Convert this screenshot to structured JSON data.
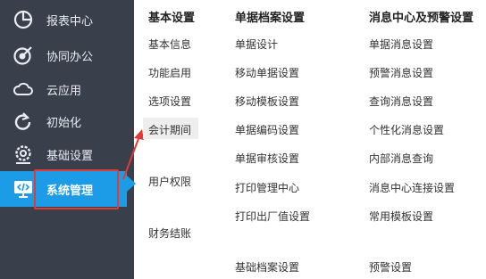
{
  "sidebar": {
    "items": [
      {
        "label": "报表中心",
        "icon": "pie-chart-icon"
      },
      {
        "label": "协同办公",
        "icon": "target-icon"
      },
      {
        "label": "云应用",
        "icon": "cloud-icon"
      },
      {
        "label": "初始化",
        "icon": "refresh-icon"
      },
      {
        "label": "基础设置",
        "icon": "gear-icon"
      },
      {
        "label": "系统管理",
        "icon": "code-monitor-icon"
      }
    ],
    "active_index": 5,
    "colors": {
      "background": "#3a3f4c",
      "active": "#1c9be6",
      "highlight_border": "#e23a35"
    }
  },
  "columns": [
    {
      "title": "基本设置",
      "items": [
        "基本信息",
        "功能启用",
        "选项设置",
        "会计期间",
        "用户权限",
        "财务结账"
      ]
    },
    {
      "title": "单据档案设置",
      "items": [
        "单据设计",
        "移动单据设置",
        "移动模板设置",
        "单据编码设置",
        "单据审核设置",
        "打印管理中心",
        "打印出厂值设置",
        "基础档案设置"
      ]
    },
    {
      "title": "消息中心及预警设置",
      "items": [
        "单据消息设置",
        "预警消息设置",
        "查询消息设置",
        "个性化消息设置",
        "内部消息查询",
        "消息中心连接设置",
        "常用模板设置",
        "预警设置"
      ]
    }
  ]
}
